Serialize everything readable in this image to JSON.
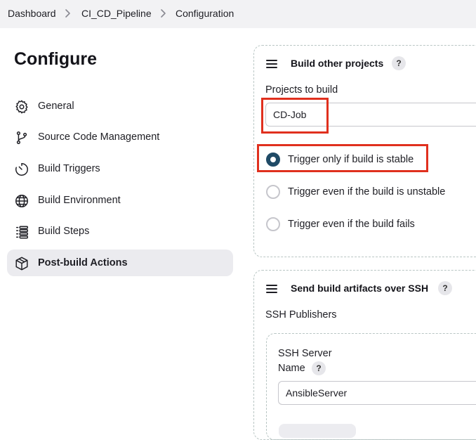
{
  "breadcrumb": {
    "items": [
      "Dashboard",
      "CI_CD_Pipeline",
      "Configuration"
    ]
  },
  "sidebar": {
    "title": "Configure",
    "items": [
      {
        "label": "General",
        "icon": "gear-icon"
      },
      {
        "label": "Source Code Management",
        "icon": "branch-icon"
      },
      {
        "label": "Build Triggers",
        "icon": "timer-icon"
      },
      {
        "label": "Build Environment",
        "icon": "globe-icon"
      },
      {
        "label": "Build Steps",
        "icon": "list-icon"
      },
      {
        "label": "Post-build Actions",
        "icon": "package-icon",
        "active": true
      }
    ]
  },
  "build_other_projects": {
    "title": "Build other projects",
    "help": "?",
    "projects_label": "Projects to build",
    "projects_value": "CD-Job",
    "options": [
      {
        "label": "Trigger only if build is stable",
        "checked": true
      },
      {
        "label": "Trigger even if the build is unstable",
        "checked": false
      },
      {
        "label": "Trigger even if the build fails",
        "checked": false
      }
    ]
  },
  "ssh_section": {
    "title": "Send build artifacts over SSH",
    "help": "?",
    "publishers_label": "SSH Publishers",
    "server_heading": "SSH Server",
    "name_label": "Name",
    "name_help": "?",
    "name_value": "AnsibleServer"
  },
  "colors": {
    "accent": "#1f4a66",
    "highlight": "#e0301e",
    "breadcrumb_bg": "#f2f2f4",
    "active_item_bg": "#ebebef",
    "dashed_border": "#b9c6c4"
  }
}
